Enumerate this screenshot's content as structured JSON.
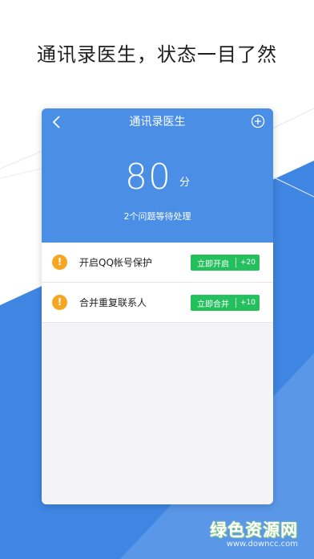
{
  "headline": "通讯录医生，状态一目了然",
  "app": {
    "title": "通讯录医生",
    "back_icon": "chevron-left-icon",
    "add_icon": "plus-circle-icon",
    "header_color": "#4a8ee6"
  },
  "score": {
    "value": "80",
    "unit": "分",
    "pending_text": "2个问题等待处理"
  },
  "issues": [
    {
      "icon": "warning-icon",
      "icon_glyph": "!",
      "label": "开启QQ帐号保护",
      "action_label": "立即开启",
      "points": "+20"
    },
    {
      "icon": "warning-icon",
      "icon_glyph": "!",
      "label": "合并重复联系人",
      "action_label": "立即合并",
      "points": "+10"
    }
  ],
  "watermark": {
    "title": "绿色资源网",
    "url": "www.downcc.com"
  },
  "colors": {
    "accent_blue": "#4a8ee6",
    "warning": "#f5a623",
    "action_green": "#25c05e"
  }
}
